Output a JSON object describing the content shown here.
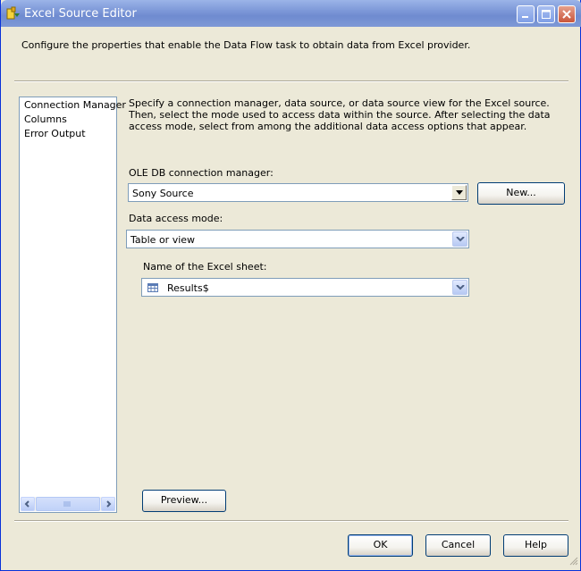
{
  "window": {
    "title": "Excel Source Editor",
    "icon": "excel-source-icon"
  },
  "description": "Configure the properties that enable the Data Flow task to obtain data from Excel provider.",
  "nav": {
    "items": [
      {
        "label": "Connection Manager"
      },
      {
        "label": "Columns"
      },
      {
        "label": "Error Output"
      }
    ]
  },
  "content": {
    "instructions": "Specify a connection manager, data source, or data source view for the Excel source. Then, select the mode used to access data within the source. After selecting the data access mode, select from among the additional data access options that appear.",
    "connection_label": "OLE DB connection manager:",
    "connection_value": "Sony Source",
    "new_button": "New...",
    "access_mode_label": "Data access mode:",
    "access_mode_value": "Table or view",
    "sheet_label": "Name of the Excel sheet:",
    "sheet_value": "Results$",
    "preview_button": "Preview..."
  },
  "footer": {
    "ok": "OK",
    "cancel": "Cancel",
    "help": "Help"
  },
  "colors": {
    "titlebar": "#7d98d8",
    "window_bg": "#ece9d8",
    "close_button": "#c9553b"
  }
}
